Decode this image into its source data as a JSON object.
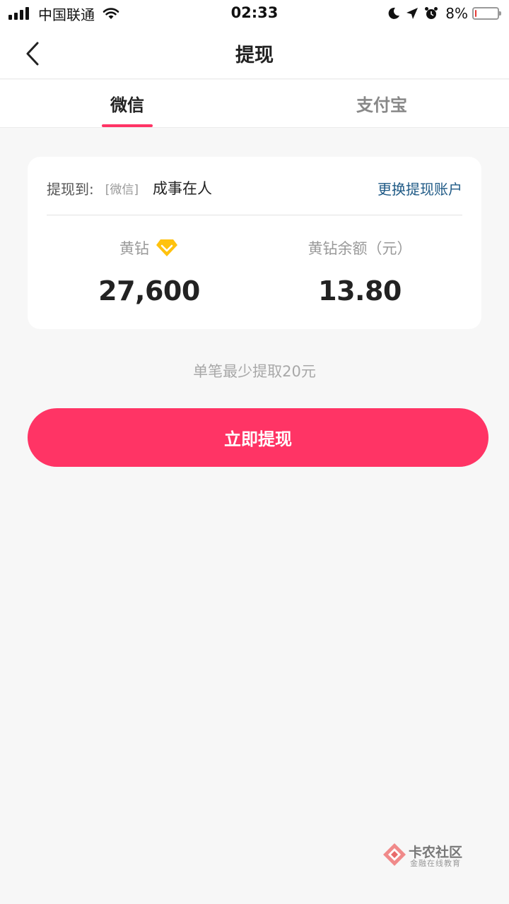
{
  "status_bar": {
    "carrier": "中国联通",
    "time": "02:33",
    "battery_percent_text": "8%",
    "battery_level": 0.08,
    "battery_color": "#e53935",
    "icons": [
      "signal-icon",
      "wifi-icon",
      "moon-icon",
      "location-arrow-icon",
      "alarm-icon",
      "battery-icon"
    ]
  },
  "nav": {
    "title": "提现",
    "back_icon": "chevron-left-icon"
  },
  "tabs": [
    {
      "label": "微信",
      "active": true
    },
    {
      "label": "支付宝",
      "active": false
    }
  ],
  "account": {
    "label": "提现到:",
    "type": "[微信]",
    "name": "成事在人",
    "change_link": "更换提现账户"
  },
  "stats": {
    "diamond_label": "黄钻",
    "diamond_icon": "yellow-diamond-icon",
    "diamond_value": "27,600",
    "balance_label": "黄钻余额（元）",
    "balance_value": "13.80"
  },
  "min_note": "单笔最少提取20元",
  "withdraw_button": "立即提现",
  "watermark": {
    "title": "卡农社区",
    "subtitle": "金融在线教育"
  },
  "colors": {
    "accent": "#ff3465",
    "link": "#1f5a86",
    "diamond": "#ffc20e"
  }
}
